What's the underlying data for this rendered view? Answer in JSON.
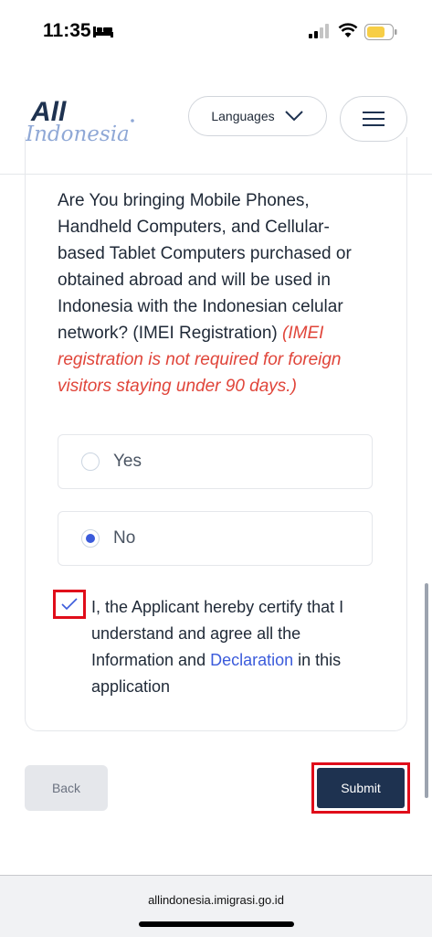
{
  "status": {
    "time": "11:35"
  },
  "header": {
    "logo_text_top": "All",
    "logo_text_bottom": "Indonesia",
    "languages_label": "Languages"
  },
  "form": {
    "question": "Are You bringing Mobile Phones, Handheld Computers, and Cellular-based Tablet Computers purchased or obtained abroad and will be used in Indonesia with the Indonesian celular network? (IMEI Registration)",
    "note": "(IMEI registration is not required for foreign visitors staying under 90 days.)",
    "options": [
      {
        "label": "Yes",
        "selected": false
      },
      {
        "label": "No",
        "selected": true
      }
    ],
    "certify_before": "I, the Applicant hereby certify that I understand and agree all the Information and ",
    "certify_link": "Declaration",
    "certify_after": " in this application",
    "certify_checked": true
  },
  "actions": {
    "back_label": "Back",
    "submit_label": "Submit"
  },
  "browser": {
    "url": "allindonesia.imigrasi.go.id"
  },
  "colors": {
    "accent": "#3b5bdb",
    "submit": "#1e3250",
    "highlight": "#e00d1a",
    "note": "#e0453a"
  }
}
